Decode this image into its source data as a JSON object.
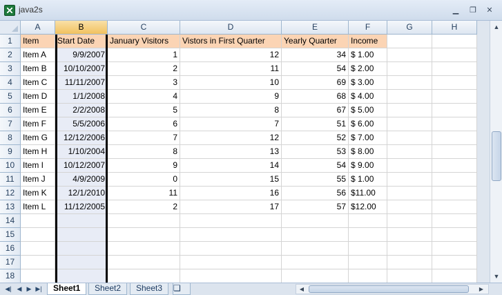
{
  "window": {
    "title": "java2s"
  },
  "columns": [
    "A",
    "B",
    "C",
    "D",
    "E",
    "F",
    "G",
    "H"
  ],
  "selected_column": "B",
  "rows": [
    [
      "Item",
      "Start Date",
      "January Visitors",
      "Vistors in First Quarter",
      "Yearly Quarter",
      "Income"
    ],
    [
      "Item A",
      "9/9/2007",
      "1",
      "12",
      "34",
      "$  1.00"
    ],
    [
      "Item B",
      "10/10/2007",
      "2",
      "11",
      "54",
      "$  2.00"
    ],
    [
      "Item C",
      "11/11/2007",
      "3",
      "10",
      "69",
      "$  3.00"
    ],
    [
      "Item D",
      "1/1/2008",
      "4",
      "9",
      "68",
      "$  4.00"
    ],
    [
      "Item E",
      "2/2/2008",
      "5",
      "8",
      "67",
      "$  5.00"
    ],
    [
      "Item F",
      "5/5/2006",
      "6",
      "7",
      "51",
      "$  6.00"
    ],
    [
      "Item G",
      "12/12/2006",
      "7",
      "12",
      "52",
      "$  7.00"
    ],
    [
      "Item H",
      "1/10/2004",
      "8",
      "13",
      "53",
      "$  8.00"
    ],
    [
      "Item I",
      "10/12/2007",
      "9",
      "14",
      "54",
      "$  9.00"
    ],
    [
      "Item J",
      "4/9/2009",
      "0",
      "15",
      "55",
      "$  1.00"
    ],
    [
      "Item K",
      "12/1/2010",
      "11",
      "16",
      "56",
      "$11.00"
    ],
    [
      "Item L",
      "11/12/2005",
      "2",
      "17",
      "57",
      "$12.00"
    ]
  ],
  "row_numbers": [
    "1",
    "2",
    "3",
    "4",
    "5",
    "6",
    "7",
    "8",
    "9",
    "10",
    "11",
    "12",
    "13",
    "14",
    "15",
    "16",
    "17",
    "18"
  ],
  "sheets": [
    {
      "label": "Sheet1",
      "active": true
    },
    {
      "label": "Sheet2",
      "active": false
    },
    {
      "label": "Sheet3",
      "active": false
    }
  ],
  "colors": {
    "header_fill": "#fbd4b4",
    "selected_header": "#f1c15f",
    "selection_fill": "#e8ecf6"
  }
}
